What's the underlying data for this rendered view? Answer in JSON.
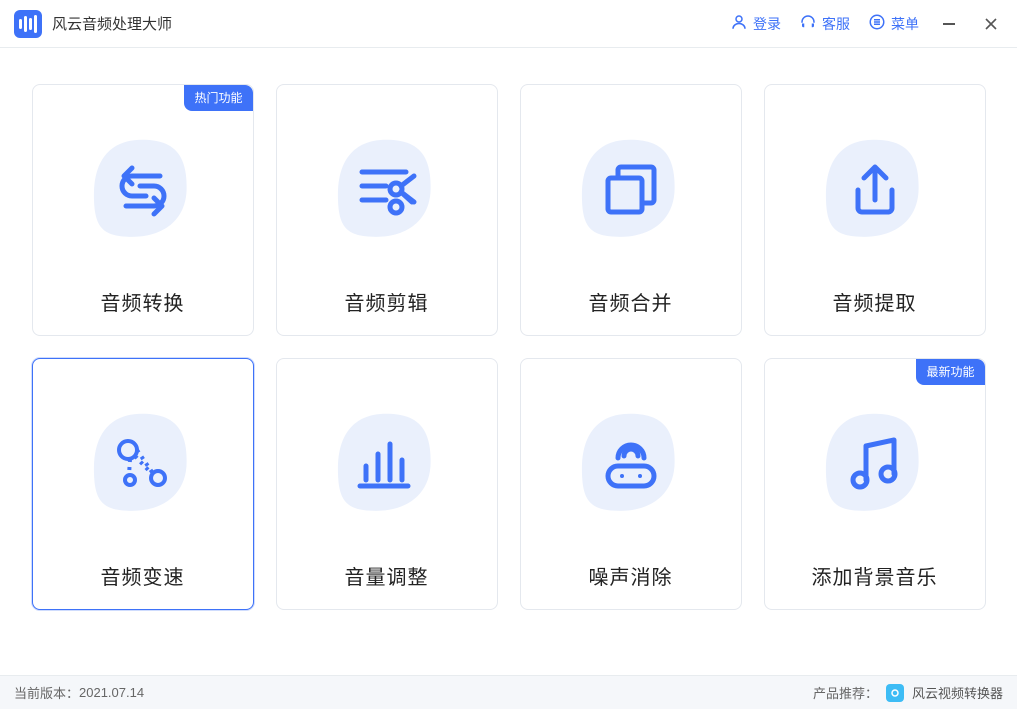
{
  "app_title": "风云音频处理大师",
  "titlebar": {
    "login": "登录",
    "support": "客服",
    "menu": "菜单"
  },
  "cards": [
    {
      "label": "音频转换",
      "badge": "热门功能",
      "selected": false,
      "icon": "convert"
    },
    {
      "label": "音频剪辑",
      "badge": "",
      "selected": false,
      "icon": "cut"
    },
    {
      "label": "音频合并",
      "badge": "",
      "selected": false,
      "icon": "merge"
    },
    {
      "label": "音频提取",
      "badge": "",
      "selected": false,
      "icon": "extract"
    },
    {
      "label": "音频变速",
      "badge": "",
      "selected": true,
      "icon": "speed"
    },
    {
      "label": "音量调整",
      "badge": "",
      "selected": false,
      "icon": "volume"
    },
    {
      "label": "噪声消除",
      "badge": "",
      "selected": false,
      "icon": "noise"
    },
    {
      "label": "添加背景音乐",
      "badge": "最新功能",
      "selected": false,
      "icon": "music"
    }
  ],
  "statusbar": {
    "version_label": "当前版本：",
    "version": "2021.07.14",
    "promo_label": "产品推荐：",
    "promo_product": "风云视频转换器"
  }
}
